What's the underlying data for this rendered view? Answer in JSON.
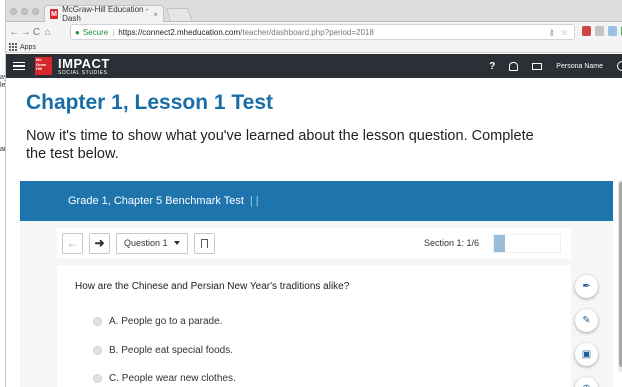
{
  "browser": {
    "tab_title": "McGraw-Hill Education - Dash",
    "tab_close": "×",
    "favicon_letter": "M",
    "secure_label": "Secure",
    "url_host": "https://connect2.mheducation.com",
    "url_path": "/teacher/dashboard.php?period=2018",
    "bookmarks_apps": "Apps"
  },
  "app": {
    "logo_lines": [
      "Mc",
      "Graw",
      "Hill",
      "Education"
    ],
    "brand": "IMPACT",
    "brand_sub": "SOCIAL STUDIES",
    "help_label": "?",
    "user_name": "Persona Name"
  },
  "side_fragment": [
    "ay",
    "le",
    "",
    "",
    "",
    "",
    "",
    "",
    "",
    "",
    "an"
  ],
  "page": {
    "title": "Chapter 1, Lesson 1 Test",
    "intro": "Now it's time to show what you've learned about the lesson question. Complete the test below."
  },
  "test": {
    "banner_title": "Grade 1, Chapter 5 Benchmark Test",
    "banner_pipes": "|  |",
    "question_select": "Question 1",
    "section_label": "Section 1: 1/6",
    "progress_fraction": 0.1667,
    "question": "How are the Chinese and Persian New Year's traditions alike?",
    "options": [
      "A.  People go to a parade.",
      "B.  People eat special foods.",
      "C.  People wear new clothes."
    ]
  },
  "colors": {
    "title_blue": "#1a6ea8",
    "banner_blue": "#1e74ad",
    "header_dark": "#2b2f36",
    "brand_red": "#d6272c"
  },
  "icons": [
    "back-arrow-icon",
    "forward-arrow-icon",
    "bookmark-icon",
    "brush-icon",
    "pencil-icon",
    "book-icon",
    "zoom-icon"
  ]
}
